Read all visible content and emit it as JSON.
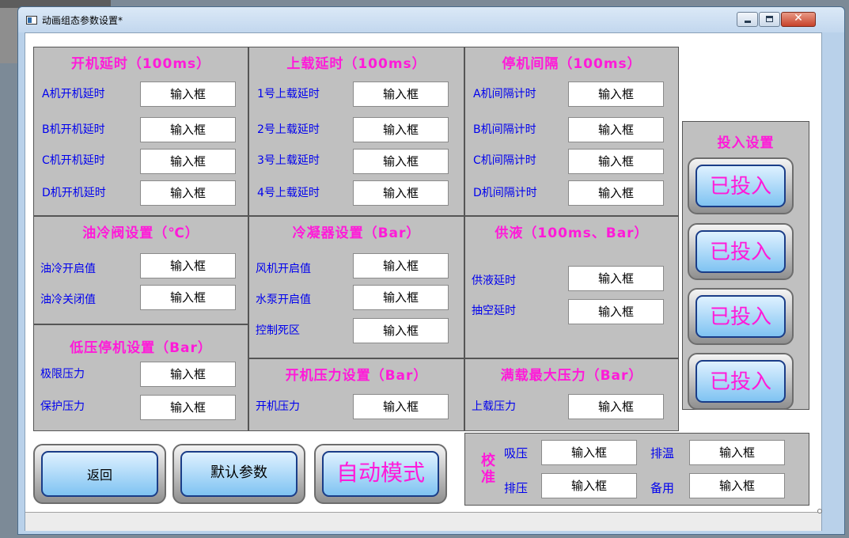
{
  "window": {
    "title": "动画组态参数设置*",
    "close_glyph": "✕"
  },
  "input_placeholder": "输入框",
  "panels": {
    "start_delay": {
      "title": "开机延时（100ms）",
      "labels": [
        "A机开机延时",
        "B机开机延时",
        "C机开机延时",
        "D机开机延时"
      ]
    },
    "load_delay": {
      "title": "上载延时（100ms）",
      "labels": [
        "1号上载延时",
        "2号上载延时",
        "3号上载延时",
        "4号上载延时"
      ]
    },
    "stop_interval": {
      "title": "停机间隔（100ms）",
      "labels": [
        "A机间隔计时",
        "B机间隔计时",
        "C机间隔计时",
        "D机间隔计时"
      ]
    },
    "oil_cool": {
      "title": "油冷阀设置（℃）",
      "labels": [
        "油冷开启值",
        "油冷关闭值"
      ]
    },
    "condenser": {
      "title": "冷凝器设置（Bar）",
      "labels": [
        "风机开启值",
        "水泵开启值",
        "控制死区"
      ]
    },
    "liquid_supply": {
      "title": "供液（100ms、Bar）",
      "labels": [
        "供液延时",
        "抽空延时"
      ]
    },
    "low_pressure": {
      "title": "低压停机设置（Bar）",
      "labels": [
        "极限压力",
        "保护压力"
      ]
    },
    "start_pressure": {
      "title": "开机压力设置（Bar）",
      "labels": [
        "开机压力"
      ]
    },
    "full_load": {
      "title": "满载最大压力（Bar）",
      "labels": [
        "上载压力"
      ]
    },
    "engage": {
      "title": "投入设置",
      "buttons": [
        "已投入",
        "已投入",
        "已投入",
        "已投入"
      ]
    },
    "calibration": {
      "title": "校准",
      "labels": [
        "吸压",
        "排温",
        "排压",
        "备用"
      ]
    }
  },
  "bottom_buttons": {
    "back": "返回",
    "defaults": "默认参数",
    "auto_mode": "自动模式"
  },
  "colors": {
    "title_pink": "#ff1ad9",
    "label_blue": "#0000ee",
    "panel_gray": "#c0c0c0"
  }
}
